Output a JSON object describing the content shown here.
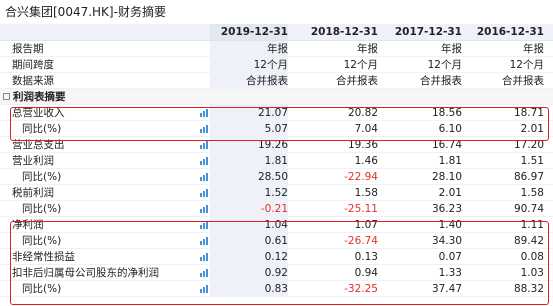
{
  "title": "合兴集团[0047.HK]-财务摘要",
  "columns": [
    "2019-12-31",
    "2018-12-31",
    "2017-12-31",
    "2016-12-31"
  ],
  "meta_rows": [
    {
      "label": "报告期",
      "values": [
        "年报",
        "年报",
        "年报",
        "年报"
      ]
    },
    {
      "label": "期间跨度",
      "values": [
        "12个月",
        "12个月",
        "12个月",
        "12个月"
      ]
    },
    {
      "label": "数据来源",
      "values": [
        "合并报表",
        "合并报表",
        "合并报表",
        "合并报表"
      ]
    }
  ],
  "section_label": "利润表摘要",
  "data_rows": [
    {
      "label": "总营业收入",
      "values": [
        "21.07",
        "20.82",
        "18.56",
        "18.71"
      ],
      "neg": [
        false,
        false,
        false,
        false
      ],
      "indent": false
    },
    {
      "label": "同比(%)",
      "values": [
        "5.07",
        "7.04",
        "6.10",
        "2.01"
      ],
      "neg": [
        false,
        false,
        false,
        false
      ],
      "indent": true
    },
    {
      "label": "营业总支出",
      "values": [
        "19.26",
        "19.36",
        "16.74",
        "17.20"
      ],
      "neg": [
        false,
        false,
        false,
        false
      ],
      "indent": false
    },
    {
      "label": "营业利润",
      "values": [
        "1.81",
        "1.46",
        "1.81",
        "1.51"
      ],
      "neg": [
        false,
        false,
        false,
        false
      ],
      "indent": false
    },
    {
      "label": "同比(%)",
      "values": [
        "28.50",
        "-22.94",
        "28.10",
        "86.97"
      ],
      "neg": [
        false,
        true,
        false,
        false
      ],
      "indent": true
    },
    {
      "label": "税前利润",
      "values": [
        "1.52",
        "1.58",
        "2.01",
        "1.58"
      ],
      "neg": [
        false,
        false,
        false,
        false
      ],
      "indent": false
    },
    {
      "label": "同比(%)",
      "values": [
        "-0.21",
        "-25.11",
        "36.23",
        "90.74"
      ],
      "neg": [
        true,
        true,
        false,
        false
      ],
      "indent": true
    },
    {
      "label": "净利润",
      "values": [
        "1.04",
        "1.07",
        "1.40",
        "1.11"
      ],
      "neg": [
        false,
        false,
        false,
        false
      ],
      "indent": false
    },
    {
      "label": "同比(%)",
      "values": [
        "0.61",
        "-26.74",
        "34.30",
        "89.42"
      ],
      "neg": [
        false,
        true,
        false,
        false
      ],
      "indent": true
    },
    {
      "label": "非经常性损益",
      "values": [
        "0.12",
        "0.13",
        "0.07",
        "0.08"
      ],
      "neg": [
        false,
        false,
        false,
        false
      ],
      "indent": false
    },
    {
      "label": "扣非后归属母公司股东的净利润",
      "values": [
        "0.92",
        "0.94",
        "1.33",
        "1.03"
      ],
      "neg": [
        false,
        false,
        false,
        false
      ],
      "indent": false
    },
    {
      "label": "同比(%)",
      "values": [
        "0.83",
        "-32.25",
        "37.47",
        "88.32"
      ],
      "neg": [
        false,
        true,
        false,
        false
      ],
      "indent": true
    }
  ],
  "colors": {
    "negative": "#e0302e",
    "highlight_box": "#e02020",
    "header_bg": "#eef1f7",
    "bar_icon": "#4a90d9"
  }
}
